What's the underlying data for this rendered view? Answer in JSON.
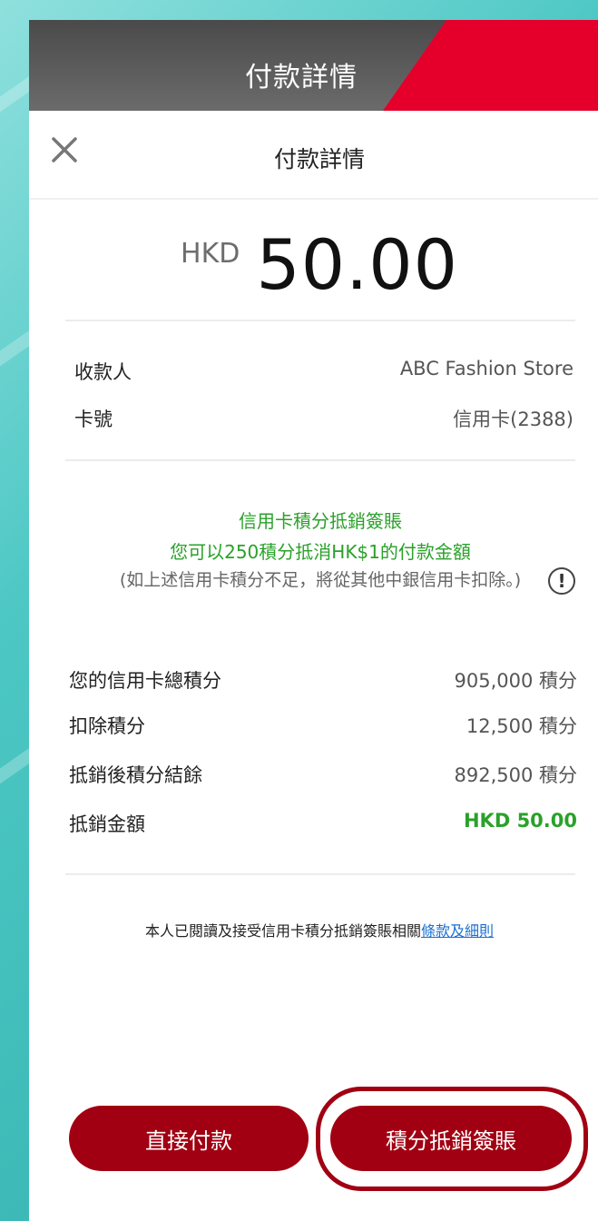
{
  "banner": {
    "title": "付款詳情"
  },
  "nav": {
    "title": "付款詳情"
  },
  "amount": {
    "currency": "HKD",
    "value": "50.00"
  },
  "details": [
    {
      "label": "收款人",
      "value": "ABC Fashion Store"
    },
    {
      "label": "卡號",
      "value": "信用卡(2388)"
    }
  ],
  "notice": {
    "line1": "信用卡積分抵銷簽賬",
    "line2": "您可以250積分抵消HK$1的付款金額",
    "note": "(如上述信用卡積分不足，將從其他中銀信用卡扣除。)"
  },
  "points": [
    {
      "label": "您的信用卡總積分",
      "value": "905,000 積分"
    },
    {
      "label": "扣除積分",
      "value": "12,500 積分"
    },
    {
      "label": "抵銷後積分結餘",
      "value": "892,500 積分"
    },
    {
      "label": "抵銷金額",
      "value": "HKD 50.00"
    }
  ],
  "terms": {
    "text": "本人已閱讀及接受信用卡積分抵銷簽賬相關",
    "link": "條款及細則"
  },
  "buttons": {
    "direct": "直接付款",
    "points": "積分抵銷簽賬"
  },
  "colors": {
    "accent_red": "#a10012",
    "banner_red": "#e4002b",
    "green": "#2aa12a",
    "link_blue": "#1a6fd1",
    "background_teal": "#4cc7c4"
  }
}
